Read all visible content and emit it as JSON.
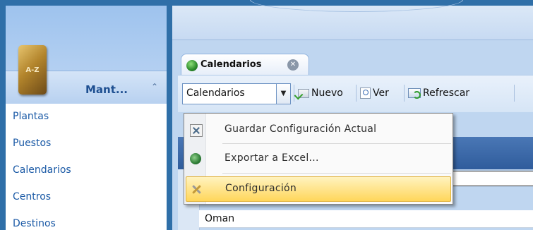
{
  "sidebar": {
    "book_text": "A-Z",
    "title": "Mant...",
    "collapse_icon": "double-chevron-up-icon",
    "items": [
      {
        "label": "Plantas"
      },
      {
        "label": "Puestos"
      },
      {
        "label": "Calendarios"
      },
      {
        "label": "Centros"
      },
      {
        "label": "Destinos"
      }
    ]
  },
  "tab": {
    "label": "Calendarios",
    "icon": "globe-icon",
    "close_icon": "close-icon"
  },
  "toolbar": {
    "combo_value": "Calendarios",
    "new_label": "Nuevo",
    "view_label": "Ver",
    "refresh_label": "Refrescar"
  },
  "menu": {
    "items": [
      {
        "label": "Guardar Configuración Actual",
        "icon": "save-config-icon"
      },
      {
        "label": "Exportar a Excel...",
        "icon": "excel-export-icon"
      },
      {
        "label": "Configuración",
        "icon": "tools-icon",
        "highlighted": true
      }
    ]
  },
  "grid": {
    "rows": [
      {
        "text": "Oman"
      }
    ]
  },
  "colors": {
    "highlight": "#ffd65b",
    "link": "#1b5aa6",
    "frame": "#2f6fa8"
  }
}
